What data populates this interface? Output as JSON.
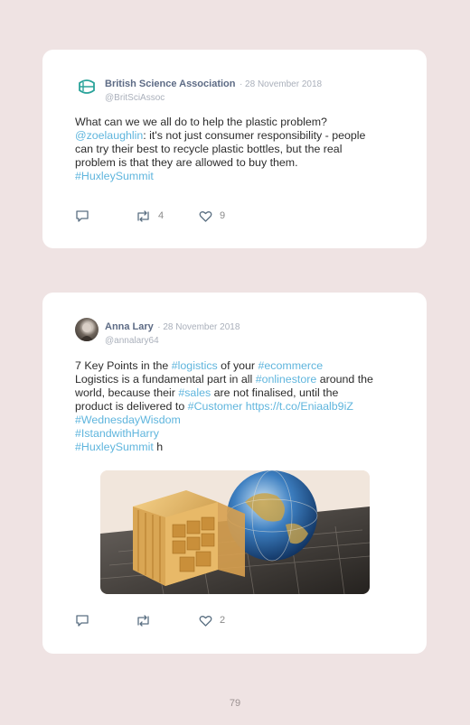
{
  "tweets": [
    {
      "name": "British Science Association",
      "date": "· 28 November 2018",
      "handle": "@BritSciAssoc",
      "lines": [
        [
          {
            "t": "What can we we all do to help the plastic problem?",
            "c": "text"
          }
        ],
        [
          {
            "t": "@zoelaughlin",
            "c": "mention"
          },
          {
            "t": ": it's not just consumer responsibility - people",
            "c": "text"
          }
        ],
        [
          {
            "t": "can try their best to recycle plastic bottles, but the real",
            "c": "text"
          }
        ],
        [
          {
            "t": "problem is that they are allowed to buy them.",
            "c": "text"
          }
        ],
        [
          {
            "t": "#HuxleySummit",
            "c": "tag"
          }
        ]
      ],
      "retweets": "4",
      "likes": "9"
    },
    {
      "name": "Anna Lary",
      "date": "· 28 November 2018",
      "handle": "@annalary64",
      "lines": [
        [
          {
            "t": "7 Key Points in the ",
            "c": "text"
          },
          {
            "t": "#logistics",
            "c": "tag"
          },
          {
            "t": " of your ",
            "c": "text"
          },
          {
            "t": "#ecommerce",
            "c": "tag"
          }
        ],
        [
          {
            "t": "Logistics is a fundamental part in all ",
            "c": "text"
          },
          {
            "t": "#onlinestore",
            "c": "tag"
          },
          {
            "t": " around the",
            "c": "text"
          }
        ],
        [
          {
            "t": "world, because their ",
            "c": "text"
          },
          {
            "t": "#sales",
            "c": "tag"
          },
          {
            "t": " are not finalised, until the",
            "c": "text"
          }
        ],
        [
          {
            "t": "product is delivered to ",
            "c": "text"
          },
          {
            "t": "#Customer",
            "c": "tag"
          },
          {
            "t": " ",
            "c": "text"
          },
          {
            "t": "https://t.co/Eniaalb9iZ",
            "c": "link"
          }
        ],
        [
          {
            "t": "#WednesdayWisdom",
            "c": "tag"
          }
        ],
        [
          {
            "t": "#IstandwithHarry",
            "c": "tag"
          }
        ],
        [
          {
            "t": "#HuxleySummit",
            "c": "tag"
          },
          {
            "t": " h",
            "c": "text"
          }
        ]
      ],
      "retweets": "",
      "likes": "2"
    }
  ],
  "icons": {
    "reply": "reply-icon",
    "retweet": "retweet-icon",
    "like": "heart-icon",
    "logo": "bsa-logo-icon"
  },
  "colors": {
    "hashtag": "#5fb5dd",
    "name": "#5d6b85",
    "background": "#efe3e3"
  },
  "page_number": "79"
}
